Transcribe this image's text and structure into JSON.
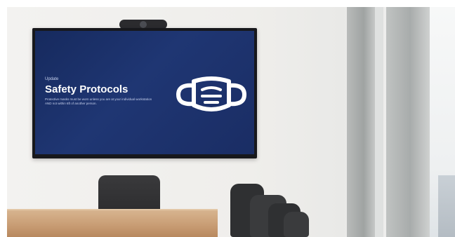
{
  "screen": {
    "eyebrow": "Update",
    "title": "Safety Protocols",
    "body": "Protective masks must be worn unless you are at your individual workstation AND not within 6ft of another person.",
    "footer_left": "",
    "footer_right": ""
  },
  "colors": {
    "screen_bg": "#1f3673",
    "title": "#ffffff",
    "table_wood": "#c79b72",
    "chair": "#2f3032"
  },
  "icons": {
    "screen_icon": "face-mask-icon"
  }
}
